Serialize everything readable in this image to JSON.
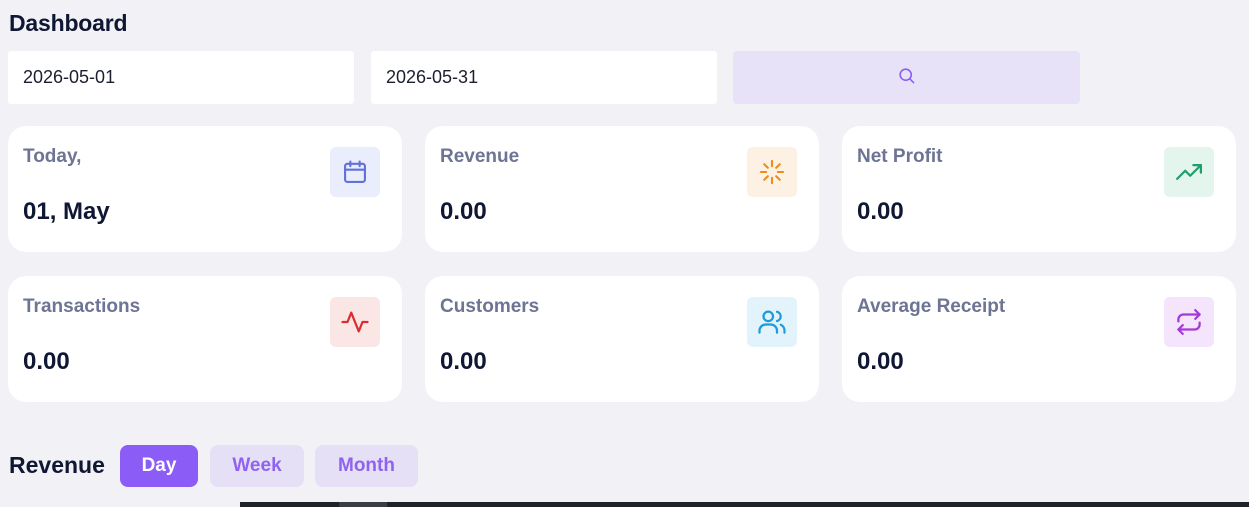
{
  "header": {
    "title": "Dashboard"
  },
  "filters": {
    "date_from": "2026-05-01",
    "date_to": "2026-05-31",
    "search_icon": "search-icon"
  },
  "cards": [
    {
      "label": "Today,",
      "value": "01, May",
      "icon": "calendar-icon",
      "icon_color": "#6271d8",
      "icon_bg": "#eaedfc"
    },
    {
      "label": "Revenue",
      "value": "0.00",
      "icon": "loader-icon",
      "icon_color": "#ef8b17",
      "icon_bg": "#fdf1e3"
    },
    {
      "label": "Net Profit",
      "value": "0.00",
      "icon": "trending-up-icon",
      "icon_color": "#1f9e6b",
      "icon_bg": "#e4f5ee"
    },
    {
      "label": "Transactions",
      "value": "0.00",
      "icon": "activity-icon",
      "icon_color": "#de2b2b",
      "icon_bg": "#fbe6e6"
    },
    {
      "label": "Customers",
      "value": "0.00",
      "icon": "users-icon",
      "icon_color": "#1d9bd8",
      "icon_bg": "#e3f3fc"
    },
    {
      "label": "Average Receipt",
      "value": "0.00",
      "icon": "repeat-icon",
      "icon_color": "#a23ad8",
      "icon_bg": "#f4e4fc"
    }
  ],
  "revenue": {
    "title": "Revenue",
    "periods": [
      "Day",
      "Week",
      "Month"
    ],
    "active_period": "Day"
  },
  "colors": {
    "accent": "#8b5cf6",
    "accent_soft": "#e6e0f7",
    "background": "#f1f1f6"
  }
}
